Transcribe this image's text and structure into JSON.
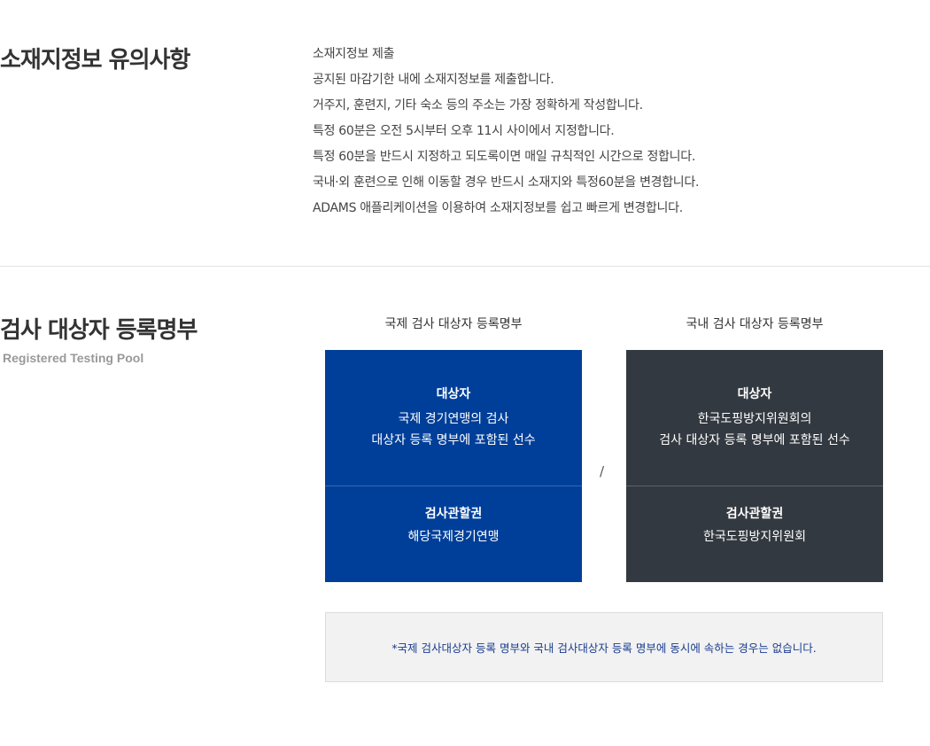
{
  "notice_section": {
    "title": "소재지정보 유의사항",
    "items": [
      "소재지정보 제출",
      "공지된 마감기한 내에 소재지정보를 제출합니다.",
      "거주지, 훈련지, 기타 숙소 등의 주소는 가장 정확하게 작성합니다.",
      "특정 60분은 오전 5시부터 오후 11시 사이에서 지정합니다.",
      "특정 60분을 반드시 지정하고 되도록이면 매일 규칙적인 시간으로 정합니다.",
      "국내·외 훈련으로 인해 이동할 경우 반드시 소재지와 특정60분을 변경합니다.",
      "ADAMS 애플리케이션을 이용하여 소재지정보를 쉽고 빠르게 변경합니다."
    ]
  },
  "rtp_section": {
    "title": "검사 대상자 등록명부",
    "subtitle": "Registered Testing Pool",
    "separator": "/",
    "international": {
      "heading": "국제 검사 대상자 등록명부",
      "target_label": "대상자",
      "target_line1": "국제 경기연맹의 검사",
      "target_line2": "대상자 등록 명부에 포함된 선수",
      "authority_label": "검사관할권",
      "authority_value": "해당국제경기연맹"
    },
    "domestic": {
      "heading": "국내 검사 대상자 등록명부",
      "target_label": "대상자",
      "target_line1": "한국도핑방지위원회의",
      "target_line2": "검사 대상자 등록 명부에 포함된 선수",
      "authority_label": "검사관할권",
      "authority_value": "한국도핑방지위원회"
    },
    "note": "*국제 검사대상자 등록 명부와 국내 검사대상자 등록 명부에 동시에 속하는 경우는 없습니다."
  },
  "colors": {
    "international_card": "#003f99",
    "domestic_card": "#333940",
    "note_text": "#1a3d8f"
  }
}
